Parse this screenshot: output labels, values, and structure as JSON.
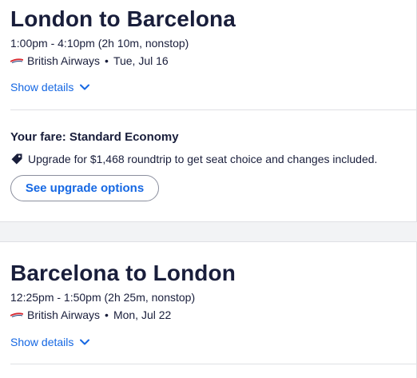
{
  "outbound": {
    "route": "London to Barcelona",
    "times": "1:00pm - 4:10pm (2h 10m, nonstop)",
    "airline": "British Airways",
    "separator": "•",
    "date": "Tue, Jul 16",
    "details_label": "Show details"
  },
  "fare": {
    "title": "Your fare: Standard Economy",
    "upgrade_text": "Upgrade for $1,468 roundtrip to get seat choice and changes included.",
    "upgrade_button": "See upgrade options"
  },
  "return": {
    "route": "Barcelona to London",
    "times": "12:25pm - 1:50pm (2h 25m, nonstop)",
    "airline": "British Airways",
    "separator": "•",
    "date": "Mon, Jul 22",
    "details_label": "Show details"
  },
  "icons": {
    "airline_logo": "british-airways-logo",
    "chevron": "chevron-down-icon",
    "tag": "tag-icon"
  },
  "colors": {
    "link": "#1668e3",
    "text": "#191e3b",
    "airline_red": "#d7262e",
    "airline_blue": "#1d3c79"
  }
}
